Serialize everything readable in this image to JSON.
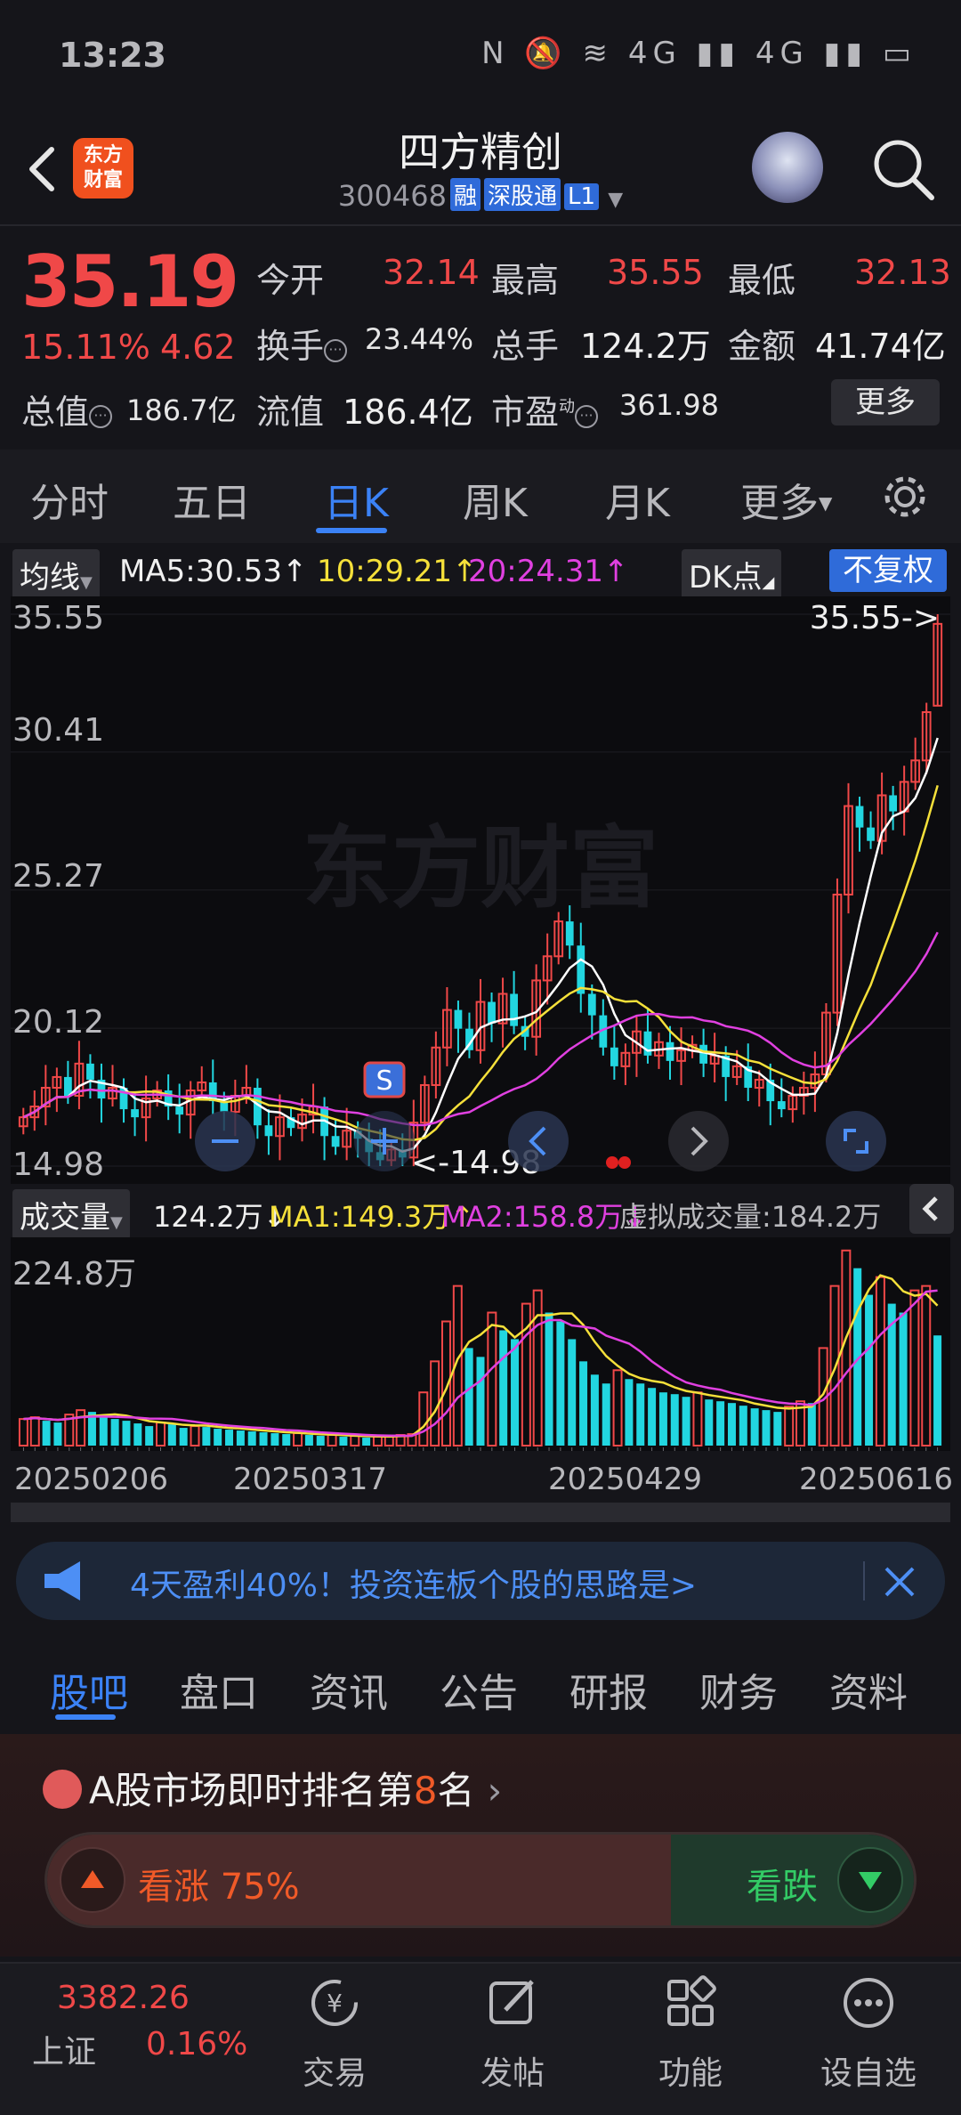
{
  "status_bar": {
    "time": "13:23",
    "icons": "N  🔕  ≋  4G ▮▮  4G ▮▮  ▭"
  },
  "header": {
    "logo_text_1": "东方",
    "logo_text_2": "财富",
    "stock_name": "四方精创",
    "stock_code": "300468",
    "tags": [
      "融",
      "深股通",
      "L1"
    ]
  },
  "quote": {
    "price": "35.19",
    "change_pct": "15.11%",
    "change_abs": "4.62",
    "open_label": "今开",
    "open": "32.14",
    "high_label": "最高",
    "high": "35.55",
    "low_label": "最低",
    "low": "32.13",
    "turnover_label": "换手",
    "turnover": "23.44%",
    "volume_label": "总手",
    "volume": "124.2万",
    "amount_label": "金额",
    "amount": "41.74亿",
    "mcap_label": "总值",
    "mcap": "186.7亿",
    "float_label": "流值",
    "float": "186.4亿",
    "pe_label": "市盈",
    "pe_sup": "动",
    "pe": "361.98",
    "more_label": "更多"
  },
  "period_tabs": [
    "分时",
    "五日",
    "日K",
    "周K",
    "月K",
    "更多"
  ],
  "active_period": "日K",
  "ma_legend": {
    "selector": "均线",
    "ma5": "MA5:30.53↑",
    "ma10": "10:29.21↑",
    "ma20": "20:24.31↑",
    "dk": "DK点",
    "fq": "不复权"
  },
  "kline_axis": [
    "35.55",
    "30.41",
    "25.27",
    "20.12",
    "14.98"
  ],
  "kline_marks": {
    "high_mark": "35.55->",
    "low_mark": "<-14.98",
    "s_label": "S",
    "watermark": "东方财富"
  },
  "vol_legend": {
    "selector": "成交量",
    "vol": "124.2万↓",
    "ma1": "MA1:149.3万↑",
    "ma2": "MA2:158.8万↓",
    "virtual": "虚拟成交量:184.2万"
  },
  "vol_axis": "224.8万",
  "dates": [
    "20250206",
    "20250317",
    "20250429",
    "20250616"
  ],
  "banner": {
    "text": "4天盈利40%！投资连板个股的思路是>"
  },
  "content_tabs": [
    "股吧",
    "盘口",
    "资讯",
    "公告",
    "研报",
    "财务",
    "资料"
  ],
  "rank": {
    "prefix": "A股市场即时排名第",
    "rank": "8",
    "suffix": "名"
  },
  "vote": {
    "up_label": "看涨 75%",
    "down_label": "看跌",
    "up_pct": 75
  },
  "bottom_bar": {
    "index_value": "3382.26",
    "index_name": "上证",
    "index_pct": "0.16%",
    "items": [
      "交易",
      "发帖",
      "功能",
      "设自选"
    ]
  },
  "colors": {
    "up": "#f04848",
    "down": "#22d6e0",
    "accent": "#3b82f6",
    "ma5": "#ffffff",
    "ma10": "#f5e03a",
    "ma20": "#e040e0"
  },
  "chart_data": [
    {
      "type": "candlestick",
      "title": "",
      "ylim": [
        14.98,
        35.55
      ],
      "y_ticks": [
        35.55,
        30.41,
        25.27,
        20.12,
        14.98
      ],
      "x_ticks": [
        "20250206",
        "20250317",
        "20250429",
        "20250616"
      ],
      "close_series": [
        16.8,
        17.2,
        17.9,
        18.3,
        17.6,
        18.8,
        18.2,
        17.5,
        17.9,
        17.1,
        16.8,
        17.5,
        17.8,
        17.2,
        16.9,
        17.8,
        18.1,
        17.4,
        17.0,
        17.6,
        17.9,
        16.5,
        16.1,
        16.8,
        16.4,
        16.9,
        17.2,
        16.1,
        15.7,
        16.3,
        16.0,
        15.5,
        15.2,
        15.6,
        15.3,
        16.6,
        18.0,
        19.4,
        20.8,
        20.1,
        19.3,
        21.1,
        20.3,
        21.4,
        20.2,
        19.8,
        21.9,
        22.8,
        24.1,
        23.2,
        21.4,
        20.6,
        19.4,
        18.7,
        19.2,
        20.0,
        19.1,
        19.6,
        18.9,
        19.3,
        19.5,
        18.8,
        19.1,
        18.3,
        18.7,
        17.9,
        18.2,
        17.4,
        17.1,
        17.6,
        17.9,
        18.4,
        20.7,
        25.1,
        28.4,
        27.6,
        27.1,
        28.8,
        28.2,
        29.3,
        30.1,
        31.9,
        35.19
      ],
      "ma5": 30.53,
      "ma10": 29.21,
      "ma20": 24.31
    },
    {
      "type": "bar",
      "title": "",
      "ylim": [
        0,
        224.8
      ],
      "unit": "万",
      "values": [
        30,
        32,
        28,
        26,
        35,
        40,
        38,
        33,
        30,
        28,
        25,
        22,
        26,
        24,
        20,
        22,
        21,
        19,
        18,
        17,
        16,
        15,
        14,
        13,
        14,
        12,
        11,
        12,
        10,
        11,
        9,
        10,
        11,
        12,
        13,
        60,
        95,
        140,
        180,
        110,
        100,
        150,
        130,
        120,
        160,
        175,
        150,
        140,
        120,
        95,
        80,
        70,
        85,
        75,
        70,
        65,
        60,
        58,
        55,
        60,
        52,
        50,
        48,
        45,
        42,
        40,
        38,
        44,
        50,
        48,
        110,
        180,
        220,
        200,
        170,
        190,
        160,
        150,
        175,
        180,
        124.2
      ],
      "ma1": 149.3,
      "ma2": 158.8
    }
  ]
}
